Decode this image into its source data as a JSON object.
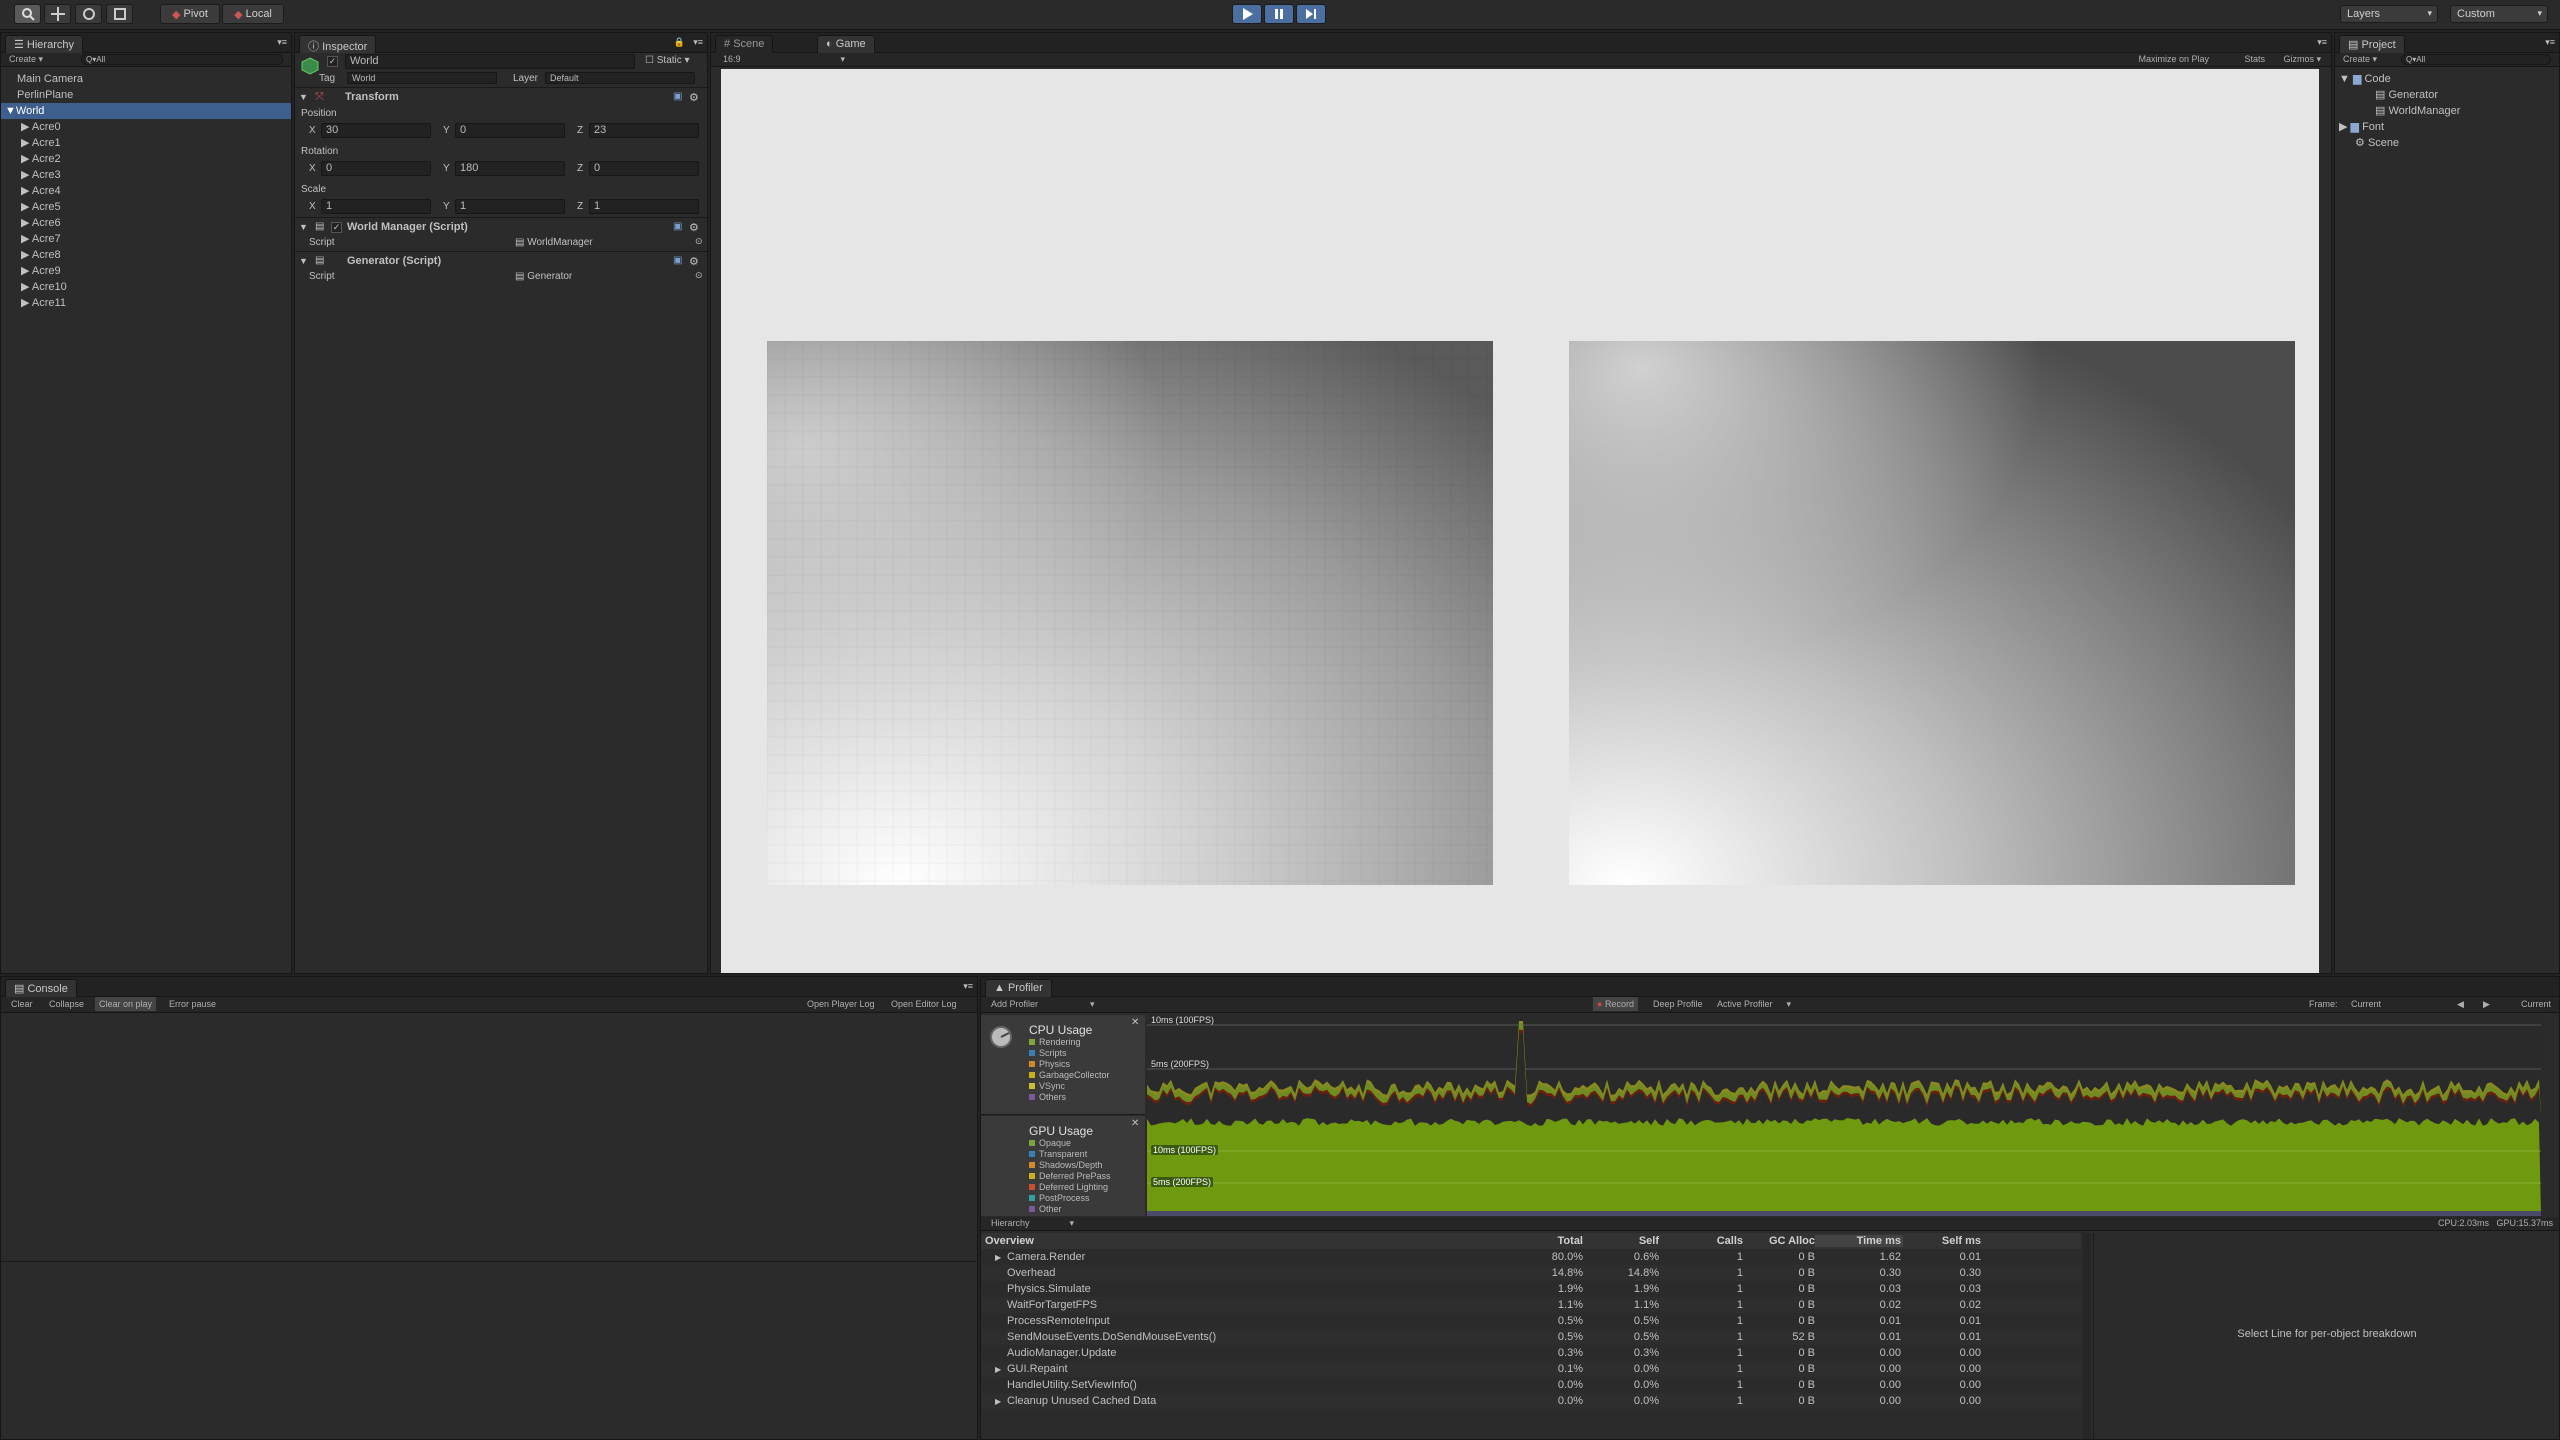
{
  "toolbar": {
    "pivot_label": "Pivot",
    "local_label": "Local",
    "layers_label": "Layers",
    "layout_label": "Custom"
  },
  "hierarchy": {
    "tab": "Hierarchy",
    "create_label": "Create",
    "search_placeholder": "Q▾All",
    "items": [
      {
        "label": "Main Camera"
      },
      {
        "label": "PerlinPlane"
      },
      {
        "label": "World"
      },
      {
        "label": "Acre0"
      },
      {
        "label": "Acre1"
      },
      {
        "label": "Acre2"
      },
      {
        "label": "Acre3"
      },
      {
        "label": "Acre4"
      },
      {
        "label": "Acre5"
      },
      {
        "label": "Acre6"
      },
      {
        "label": "Acre7"
      },
      {
        "label": "Acre8"
      },
      {
        "label": "Acre9"
      },
      {
        "label": "Acre10"
      },
      {
        "label": "Acre11"
      }
    ]
  },
  "inspector": {
    "tab": "Inspector",
    "object_name": "World",
    "static_label": "Static",
    "tag_label": "Tag",
    "tag_value": "World",
    "layer_label": "Layer",
    "layer_value": "Default",
    "transform": {
      "title": "Transform",
      "position_label": "Position",
      "rotation_label": "Rotation",
      "scale_label": "Scale",
      "x_label": "X",
      "y_label": "Y",
      "z_label": "Z",
      "position": {
        "x": "30",
        "y": "0",
        "z": "23"
      },
      "rotation": {
        "x": "0",
        "y": "180",
        "z": "0"
      },
      "scale": {
        "x": "1",
        "y": "1",
        "z": "1"
      }
    },
    "world_manager": {
      "title": "World Manager (Script)",
      "script_label": "Script",
      "script_value": "WorldManager"
    },
    "generator": {
      "title": "Generator (Script)",
      "script_label": "Script",
      "script_value": "Generator"
    }
  },
  "views": {
    "scene_tab": "Scene",
    "game_tab": "Game",
    "aspect": "16:9",
    "maximize_label": "Maximize on Play",
    "stats_label": "Stats",
    "gizmos_label": "Gizmos"
  },
  "project": {
    "tab": "Project",
    "create_label": "Create",
    "search_placeholder": "Q▾All",
    "items": [
      {
        "label": "Code"
      },
      {
        "label": "Generator"
      },
      {
        "label": "WorldManager"
      },
      {
        "label": "Font"
      },
      {
        "label": "Scene"
      }
    ]
  },
  "console": {
    "tab": "Console",
    "clear": "Clear",
    "collapse": "Collapse",
    "clear_on_play": "Clear on play",
    "error_pause": "Error pause",
    "open_player_log": "Open Player Log",
    "open_editor_log": "Open Editor Log"
  },
  "profiler": {
    "tab": "Profiler",
    "add_profiler": "Add Profiler",
    "record": "Record",
    "deep_profile": "Deep Profile",
    "active_profiler": "Active Profiler",
    "frame_label": "Frame:",
    "frame_value": "Current",
    "current_label": "Current",
    "cpu": {
      "title": "CPU Usage",
      "legend": [
        "Rendering",
        "Scripts",
        "Physics",
        "GarbageCollector",
        "VSync",
        "Others"
      ],
      "legend_colors": [
        "#7ea53a",
        "#3a7fb5",
        "#d08a2a",
        "#c8b020",
        "#c8c030",
        "#7a5a9a"
      ],
      "line_10ms": "10ms (100FPS)",
      "line_5ms": "5ms (200FPS)"
    },
    "gpu": {
      "title": "GPU Usage",
      "legend": [
        "Opaque",
        "Transparent",
        "Shadows/Depth",
        "Deferred PrePass",
        "Deferred Lighting",
        "PostProcess",
        "Other"
      ],
      "legend_colors": [
        "#7ea53a",
        "#3a7fb5",
        "#d08a2a",
        "#c8b020",
        "#c85030",
        "#30a0a0",
        "#7a5a9a"
      ],
      "line_10ms": "10ms (100FPS)",
      "line_5ms": "5ms (200FPS)"
    },
    "view_mode": "Hierarchy",
    "cpu_time": "CPU:2.03ms",
    "gpu_time": "GPU:15.37ms",
    "columns": [
      "Overview",
      "Total",
      "Self",
      "Calls",
      "GC Alloc",
      "Time ms",
      "Self ms"
    ],
    "rows": [
      {
        "name": "Camera.Render",
        "expand": true,
        "total": "80.0%",
        "self": "0.6%",
        "calls": "1",
        "gc": "0 B",
        "time": "1.62",
        "selfms": "0.01"
      },
      {
        "name": "Overhead",
        "expand": false,
        "total": "14.8%",
        "self": "14.8%",
        "calls": "1",
        "gc": "0 B",
        "time": "0.30",
        "selfms": "0.30"
      },
      {
        "name": "Physics.Simulate",
        "expand": false,
        "total": "1.9%",
        "self": "1.9%",
        "calls": "1",
        "gc": "0 B",
        "time": "0.03",
        "selfms": "0.03"
      },
      {
        "name": "WaitForTargetFPS",
        "expand": false,
        "total": "1.1%",
        "self": "1.1%",
        "calls": "1",
        "gc": "0 B",
        "time": "0.02",
        "selfms": "0.02"
      },
      {
        "name": "ProcessRemoteInput",
        "expand": false,
        "total": "0.5%",
        "self": "0.5%",
        "calls": "1",
        "gc": "0 B",
        "time": "0.01",
        "selfms": "0.01"
      },
      {
        "name": "SendMouseEvents.DoSendMouseEvents()",
        "expand": false,
        "total": "0.5%",
        "self": "0.5%",
        "calls": "1",
        "gc": "52 B",
        "time": "0.01",
        "selfms": "0.01"
      },
      {
        "name": "AudioManager.Update",
        "expand": false,
        "total": "0.3%",
        "self": "0.3%",
        "calls": "1",
        "gc": "0 B",
        "time": "0.00",
        "selfms": "0.00"
      },
      {
        "name": "GUI.Repaint",
        "expand": true,
        "total": "0.1%",
        "self": "0.0%",
        "calls": "1",
        "gc": "0 B",
        "time": "0.00",
        "selfms": "0.00"
      },
      {
        "name": "HandleUtility.SetViewInfo()",
        "expand": false,
        "total": "0.0%",
        "self": "0.0%",
        "calls": "1",
        "gc": "0 B",
        "time": "0.00",
        "selfms": "0.00"
      },
      {
        "name": "Cleanup Unused Cached Data",
        "expand": true,
        "total": "0.0%",
        "self": "0.0%",
        "calls": "1",
        "gc": "0 B",
        "time": "0.00",
        "selfms": "0.00"
      }
    ],
    "detail_hint": "Select Line for per-object breakdown"
  }
}
